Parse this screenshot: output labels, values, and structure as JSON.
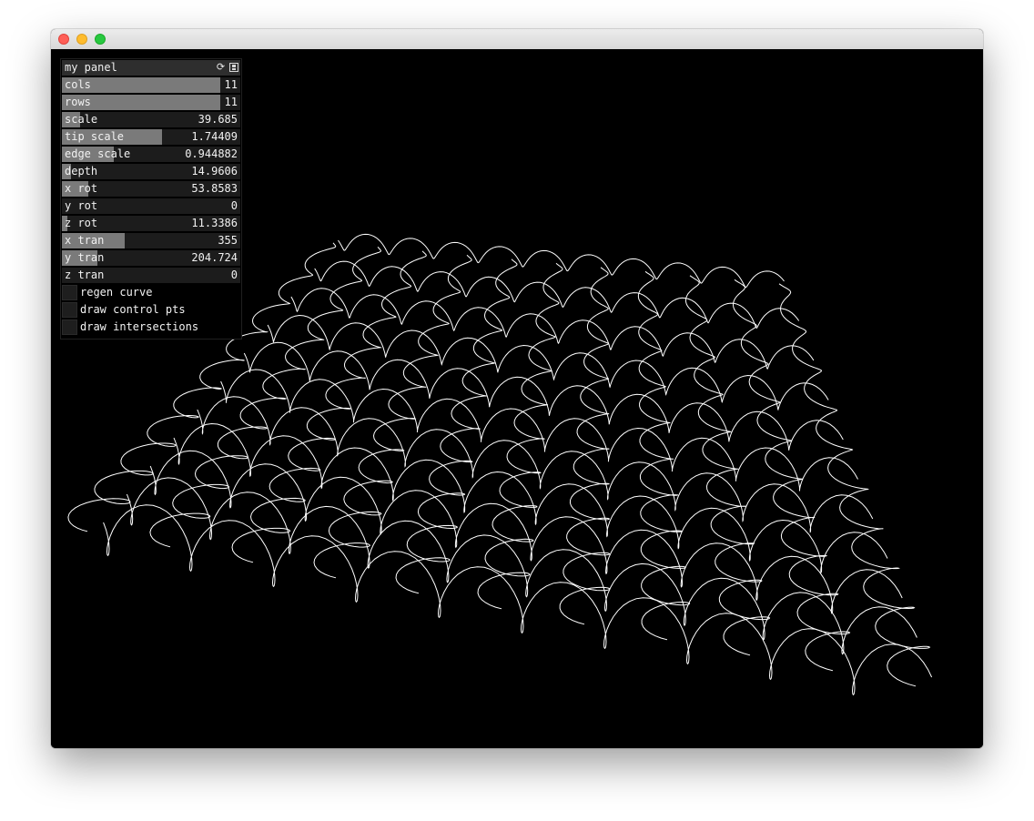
{
  "window": {
    "controls": [
      "close-button",
      "minimize-button",
      "maximize-button"
    ]
  },
  "panel": {
    "title": "my panel",
    "icons": [
      "reload-icon",
      "save-icon"
    ],
    "sliders": [
      {
        "label": "cols",
        "value": "11",
        "fill": 0.89
      },
      {
        "label": "rows",
        "value": "11",
        "fill": 0.89
      },
      {
        "label": "scale",
        "value": "39.685",
        "fill": 0.1
      },
      {
        "label": "tip scale",
        "value": "1.74409",
        "fill": 0.56
      },
      {
        "label": "edge scale",
        "value": "0.944882",
        "fill": 0.29
      },
      {
        "label": "depth",
        "value": "14.9606",
        "fill": 0.05
      },
      {
        "label": "x rot",
        "value": "53.8583",
        "fill": 0.15
      },
      {
        "label": "y rot",
        "value": "0",
        "fill": 0.0
      },
      {
        "label": "z rot",
        "value": "11.3386",
        "fill": 0.03
      },
      {
        "label": "x tran",
        "value": "355",
        "fill": 0.35
      },
      {
        "label": "y tran",
        "value": "204.724",
        "fill": 0.2
      },
      {
        "label": "z tran",
        "value": "0",
        "fill": 0.0
      }
    ],
    "toggles": [
      {
        "label": "regen curve",
        "checked": false
      },
      {
        "label": "draw control pts",
        "checked": false
      },
      {
        "label": "draw intersections",
        "checked": false
      }
    ]
  },
  "scene": {
    "grid_cols": 11,
    "grid_rows": 11,
    "line_color": "#ffffff",
    "background": "#000000"
  }
}
